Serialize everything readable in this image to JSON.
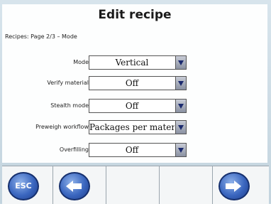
{
  "header": {
    "title": "Edit recipe",
    "subtitle": "Recipes: Page 2/3 – Mode"
  },
  "fields": [
    {
      "label": "Mode",
      "value": "Vertical"
    },
    {
      "label": "Verify material",
      "value": "Off"
    },
    {
      "label": "Stealth mode",
      "value": "Off"
    },
    {
      "label": "Preweigh workflow",
      "value": "Packages per material"
    },
    {
      "label": "Overfilling",
      "value": "Off"
    }
  ],
  "softkeys": {
    "esc_label": "ESC",
    "icons": [
      "esc-icon",
      "arrow-left-icon",
      "empty",
      "empty",
      "arrow-right-icon"
    ]
  },
  "colors": {
    "accent": "#3a66bf",
    "dropdown_arrow": "#1b2a6e",
    "background": "#c9dae3"
  }
}
